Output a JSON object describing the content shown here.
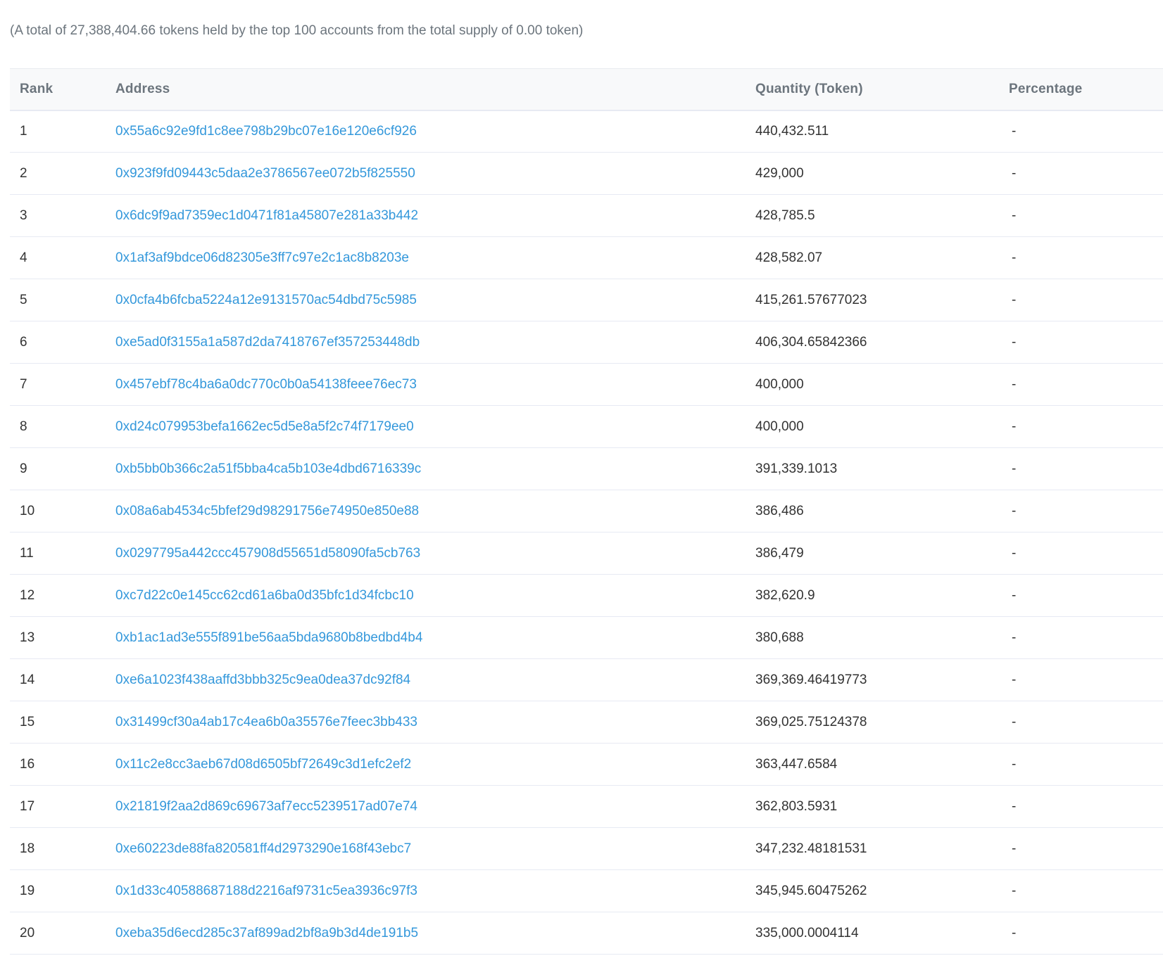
{
  "summary": "(A total of 27,388,404.66 tokens held by the top 100 accounts from the total supply of 0.00 token)",
  "table": {
    "headers": {
      "rank": "Rank",
      "address": "Address",
      "quantity": "Quantity (Token)",
      "percentage": "Percentage"
    },
    "rows": [
      {
        "rank": "1",
        "address": "0x55a6c92e9fd1c8ee798b29bc07e16e120e6cf926",
        "quantity": "440,432.511",
        "percentage": "-"
      },
      {
        "rank": "2",
        "address": "0x923f9fd09443c5daa2e3786567ee072b5f825550",
        "quantity": "429,000",
        "percentage": "-"
      },
      {
        "rank": "3",
        "address": "0x6dc9f9ad7359ec1d0471f81a45807e281a33b442",
        "quantity": "428,785.5",
        "percentage": "-"
      },
      {
        "rank": "4",
        "address": "0x1af3af9bdce06d82305e3ff7c97e2c1ac8b8203e",
        "quantity": "428,582.07",
        "percentage": "-"
      },
      {
        "rank": "5",
        "address": "0x0cfa4b6fcba5224a12e9131570ac54dbd75c5985",
        "quantity": "415,261.57677023",
        "percentage": "-"
      },
      {
        "rank": "6",
        "address": "0xe5ad0f3155a1a587d2da7418767ef357253448db",
        "quantity": "406,304.65842366",
        "percentage": "-"
      },
      {
        "rank": "7",
        "address": "0x457ebf78c4ba6a0dc770c0b0a54138feee76ec73",
        "quantity": "400,000",
        "percentage": "-"
      },
      {
        "rank": "8",
        "address": "0xd24c079953befa1662ec5d5e8a5f2c74f7179ee0",
        "quantity": "400,000",
        "percentage": "-"
      },
      {
        "rank": "9",
        "address": "0xb5bb0b366c2a51f5bba4ca5b103e4dbd6716339c",
        "quantity": "391,339.1013",
        "percentage": "-"
      },
      {
        "rank": "10",
        "address": "0x08a6ab4534c5bfef29d98291756e74950e850e88",
        "quantity": "386,486",
        "percentage": "-"
      },
      {
        "rank": "11",
        "address": "0x0297795a442ccc457908d55651d58090fa5cb763",
        "quantity": "386,479",
        "percentage": "-"
      },
      {
        "rank": "12",
        "address": "0xc7d22c0e145cc62cd61a6ba0d35bfc1d34fcbc10",
        "quantity": "382,620.9",
        "percentage": "-"
      },
      {
        "rank": "13",
        "address": "0xb1ac1ad3e555f891be56aa5bda9680b8bedbd4b4",
        "quantity": "380,688",
        "percentage": "-"
      },
      {
        "rank": "14",
        "address": "0xe6a1023f438aaffd3bbb325c9ea0dea37dc92f84",
        "quantity": "369,369.46419773",
        "percentage": "-"
      },
      {
        "rank": "15",
        "address": "0x31499cf30a4ab17c4ea6b0a35576e7feec3bb433",
        "quantity": "369,025.75124378",
        "percentage": "-"
      },
      {
        "rank": "16",
        "address": "0x11c2e8cc3aeb67d08d6505bf72649c3d1efc2ef2",
        "quantity": "363,447.6584",
        "percentage": "-"
      },
      {
        "rank": "17",
        "address": "0x21819f2aa2d869c69673af7ecc5239517ad07e74",
        "quantity": "362,803.5931",
        "percentage": "-"
      },
      {
        "rank": "18",
        "address": "0xe60223de88fa820581ff4d2973290e168f43ebc7",
        "quantity": "347,232.48181531",
        "percentage": "-"
      },
      {
        "rank": "19",
        "address": "0x1d33c40588687188d2216af9731c5ea3936c97f3",
        "quantity": "345,945.60475262",
        "percentage": "-"
      },
      {
        "rank": "20",
        "address": "0xeba35d6ecd285c37af899ad2bf8a9b3d4de191b5",
        "quantity": "335,000.0004114",
        "percentage": "-"
      }
    ]
  },
  "colors": {
    "link": "#3498db",
    "header_bg": "#f8f9fa",
    "muted_text": "#6c757d",
    "row_border": "#e7eaf3"
  }
}
